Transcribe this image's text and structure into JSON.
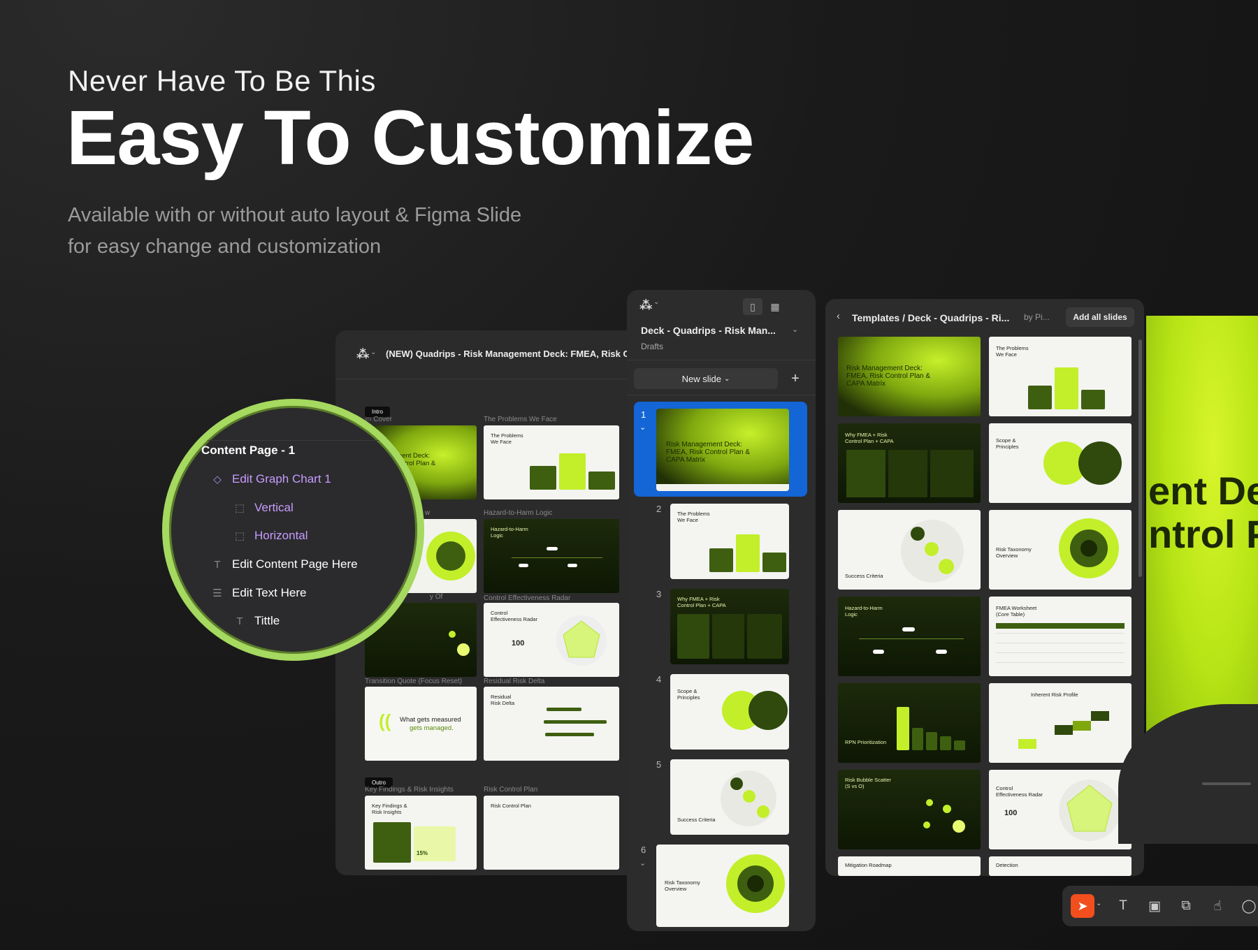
{
  "hero": {
    "subtitle": "Never Have To Be This",
    "title": "Easy To Customize",
    "description_line1": "Available with or without auto layout  & Figma Slide",
    "description_line2": "for easy change and customization"
  },
  "canvas_window": {
    "title": "(NEW) Quadrips - Risk Management Deck: FMEA, Risk Cont",
    "tag_intro": "Intro",
    "tag_outro": "Outro",
    "labels": {
      "cover": "Cover",
      "problems": "The Problems We Face",
      "hazard": "Hazard-to-Harm Logic",
      "radar": "Control Effectiveness Radar",
      "quote": "Transition Quote (Focus Reset)",
      "delta": "Residual Risk Delta",
      "findings": "Key Findings & Risk Insights",
      "plan": "Risk Control Plan",
      "w": "w",
      "yof": "y Of"
    },
    "thumbs": {
      "cover_text": "ement Deck:\nControl Plan &",
      "problems_text": "The Problems\nWe Face",
      "hazard_text": "Hazard-to-Harm\nLogic",
      "radar_text": "Control\nEffectiveness Radar",
      "radar_value": "100",
      "quote_line1": "What gets measured",
      "quote_line2": "gets managed.",
      "delta_text": "Residual\nRisk Delta",
      "findings_text": "Key Findings &\nRisk Insights",
      "findings_value": "15%",
      "plan_text": "Risk Control Plan"
    }
  },
  "layers_magnifier": {
    "items": [
      {
        "label": "Content Page - 1",
        "color": "#ffffff"
      },
      {
        "label": "Edit Graph Chart 1",
        "color": "#c79cff"
      },
      {
        "label": "Vertical",
        "color": "#c79cff"
      },
      {
        "label": "Horizontal",
        "color": "#c79cff"
      },
      {
        "label": "Edit Content Page Here",
        "color": "#ffffff"
      },
      {
        "label": "Edit Text Here",
        "color": "#ffffff"
      },
      {
        "label": "Tittle",
        "color": "#ffffff"
      }
    ]
  },
  "slides_panel": {
    "title": "Deck - Quadrips - Risk Man...",
    "location": "Drafts",
    "new_slide": "New slide",
    "slides": [
      {
        "num": "1",
        "text": "Risk Management Deck:\nFMEA, Risk Control Plan &\nCAPA Matrix"
      },
      {
        "num": "2",
        "text": "The Problems\nWe Face"
      },
      {
        "num": "3",
        "text": "Why FMEA + Risk\nControl Plan + CAPA"
      },
      {
        "num": "4",
        "text": "Scope &\nPrinciples"
      },
      {
        "num": "5",
        "text": "Success Criteria"
      },
      {
        "num": "6",
        "text": "Risk Taxonomy\nOverview"
      }
    ]
  },
  "templates_panel": {
    "title": "Templates / Deck - Quadrips - Ri...",
    "by": "by Pi...",
    "add_all": "Add all slides",
    "tiles": [
      {
        "text": "Risk Management Deck:\nFMEA, Risk Control Plan &\nCAPA Matrix"
      },
      {
        "text": "The Problems\nWe Face"
      },
      {
        "text": "Why FMEA + Risk\nControl Plan + CAPA"
      },
      {
        "text": "Scope &\nPrinciples"
      },
      {
        "text": "Success Criteria"
      },
      {
        "text": "Risk Taxonomy\nOverview"
      },
      {
        "text": "Hazard-to-Harm\nLogic"
      },
      {
        "text": "FMEA Worksheet\n(Core Table)"
      },
      {
        "text": "RPN Prioritization"
      },
      {
        "text": "Inherent Risk Profile"
      },
      {
        "text": "Risk Bubble Scatter\n(S vs O)"
      },
      {
        "text": "Control\nEffectiveness Radar",
        "value": "100"
      },
      {
        "text": "Mitigation Roadmap"
      },
      {
        "text": "Detection"
      }
    ]
  },
  "preview": {
    "line1": "ent Dec",
    "line2": "ntrol Pl"
  },
  "colors": {
    "accent_green": "#c2ef2a",
    "selection_blue": "#1465d6",
    "figma_orange": "#f24e1e",
    "ring": "#a5d95f"
  }
}
